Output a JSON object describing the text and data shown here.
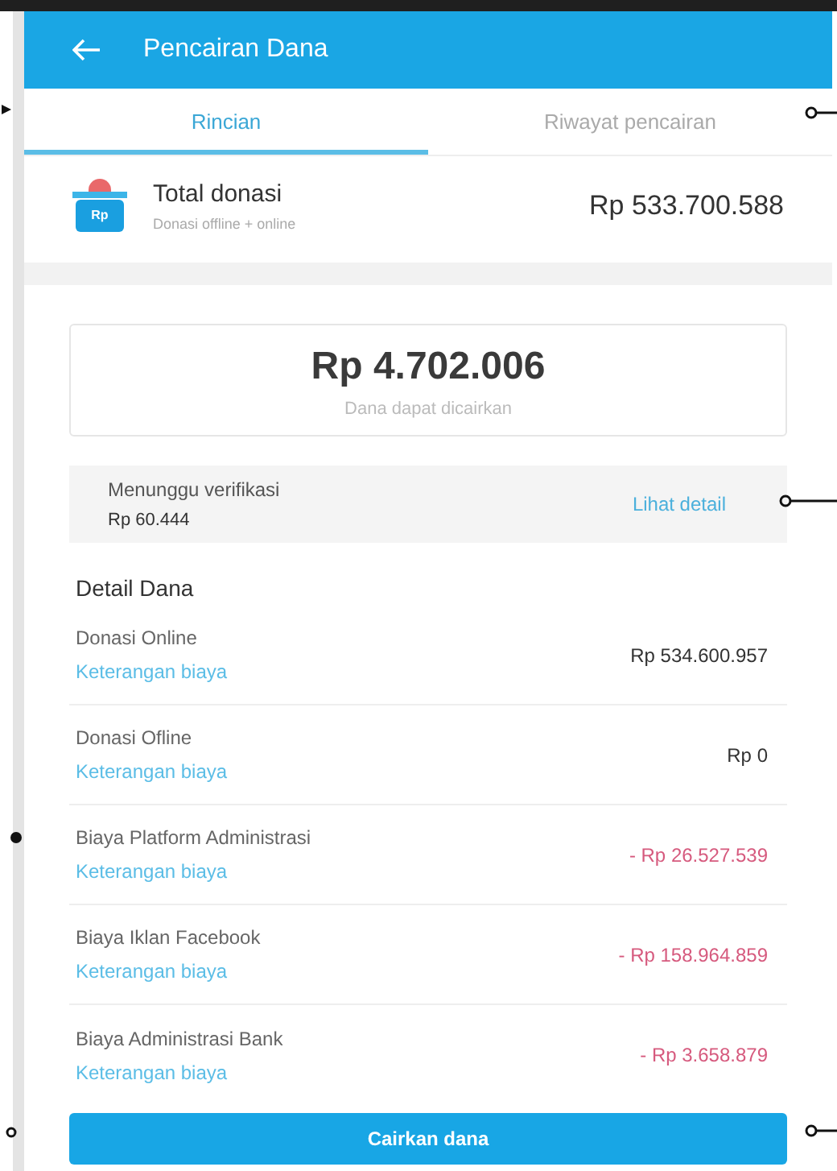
{
  "header": {
    "title": "Pencairan Dana"
  },
  "tabs": [
    {
      "label": "Rincian",
      "selected": true
    },
    {
      "label": "Riwayat pencairan",
      "selected": false
    }
  ],
  "total": {
    "title": "Total donasi",
    "subtitle": "Donasi offline + online",
    "icon_label": "Rp",
    "amount": "Rp 533.700.588"
  },
  "available": {
    "amount": "Rp 4.702.006",
    "caption": "Dana dapat dicairkan"
  },
  "pending": {
    "label": "Menunggu verifikasi",
    "amount": "Rp 60.444",
    "link": "Lihat detail"
  },
  "details": {
    "heading": "Detail Dana",
    "rows": [
      {
        "kind": "credit",
        "label": "Donasi Online",
        "link": "Keterangan biaya",
        "amount": "Rp 534.600.957"
      },
      {
        "kind": "credit",
        "label": "Donasi Ofline",
        "link": "Keterangan biaya",
        "amount": "Rp 0"
      },
      {
        "kind": "deduction",
        "label": "Biaya Platform Administrasi",
        "link": "Keterangan biaya",
        "amount": "- Rp 26.527.539"
      },
      {
        "kind": "deduction",
        "label": "Biaya Iklan Facebook",
        "link": "Keterangan biaya",
        "amount": "- Rp 158.964.859"
      },
      {
        "kind": "deduction",
        "label": "Biaya Administrasi Bank",
        "link": "Keterangan biaya",
        "amount": "- Rp 3.658.879"
      }
    ]
  },
  "button": {
    "label": "Cairkan dana"
  }
}
